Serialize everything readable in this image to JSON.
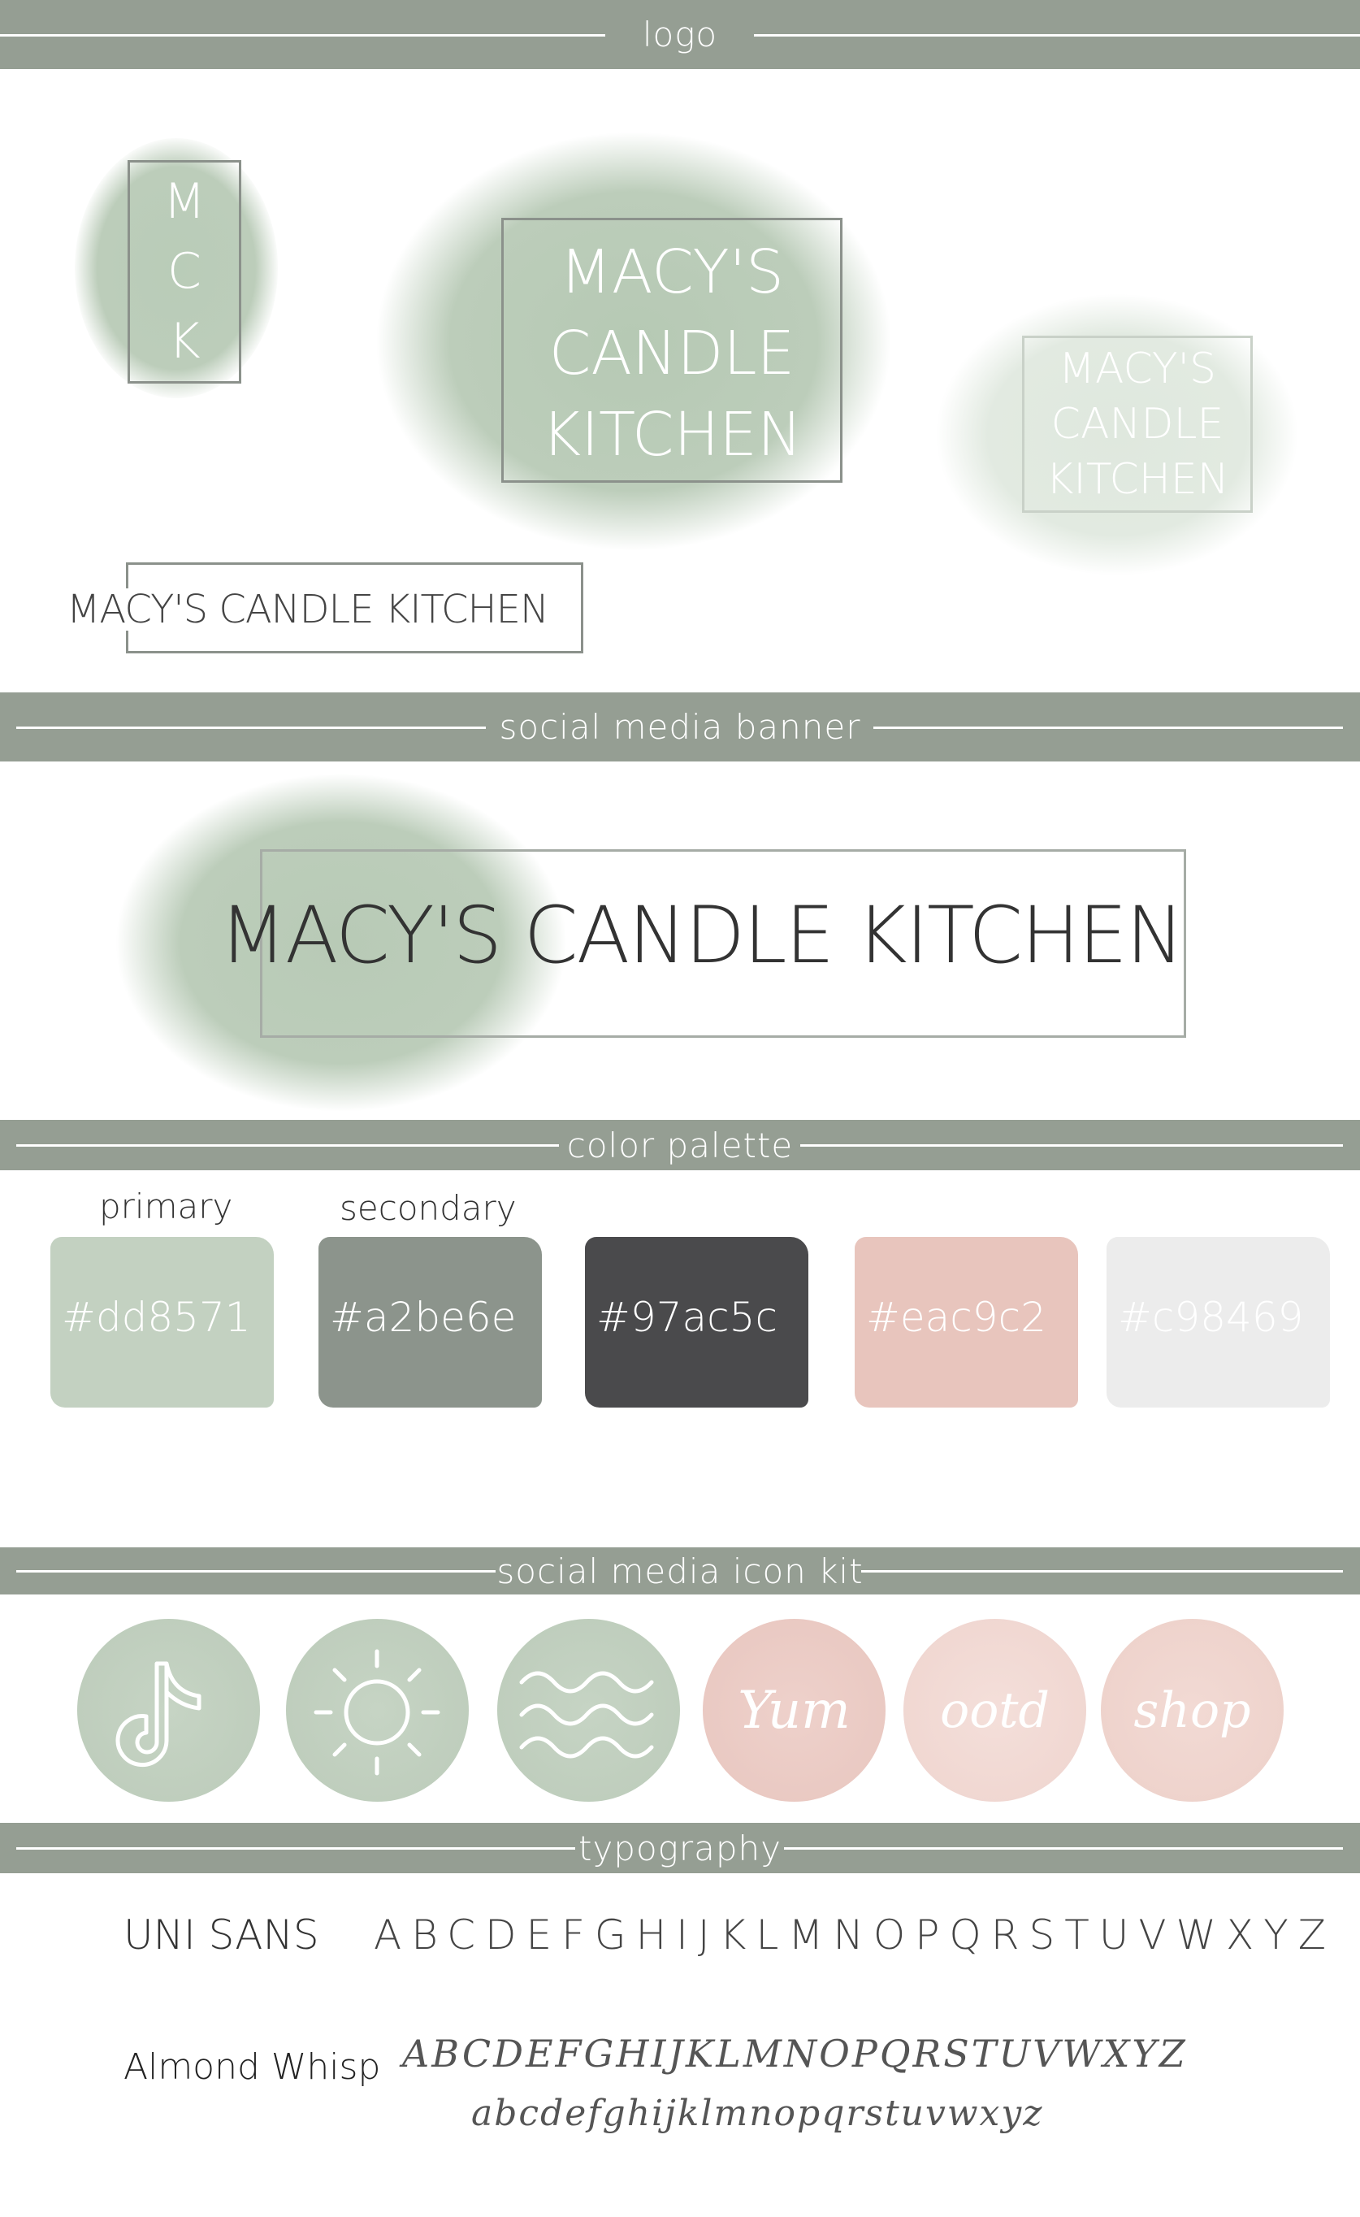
{
  "sections": {
    "logo": "logo",
    "banner": "social media banner",
    "palette": "color palette",
    "icons": "social media icon kit",
    "typography": "typography"
  },
  "logo": {
    "initials": [
      "M",
      "C",
      "K"
    ],
    "main_lines": [
      "MACY'S",
      "CANDLE",
      "KITCHEN"
    ],
    "faded_lines": [
      "MACY'S",
      "CANDLE",
      "KITCHEN"
    ],
    "wordmark": "MACY'S CANDLE KITCHEN"
  },
  "banner": {
    "wordmark": "MACY'S CANDLE KITCHEN"
  },
  "palette": {
    "primary_label": "primary",
    "secondary_label": "secondary",
    "swatches": [
      {
        "hex": "#dd8571",
        "fill": "#c3d1c1"
      },
      {
        "hex": "#a2be6e",
        "fill": "#8c948c"
      },
      {
        "hex": "#97ac5c",
        "fill": "#4a4a4c"
      },
      {
        "hex": "#eac9c2",
        "fill": "#e8c5bd"
      },
      {
        "hex": "#c98469",
        "fill": "#ececec"
      }
    ]
  },
  "icons": {
    "items": [
      {
        "name": "tiktok-icon",
        "color": "#c3d1c1",
        "text": ""
      },
      {
        "name": "sun-icon",
        "color": "#c3d1c1",
        "text": ""
      },
      {
        "name": "waves-icon",
        "color": "#c3d1c1",
        "text": ""
      },
      {
        "name": "yum-icon",
        "color": "#eccbc4",
        "text": "Yum"
      },
      {
        "name": "ootd-icon",
        "color": "#f1d8d2",
        "text": "ootd"
      },
      {
        "name": "shop-icon",
        "color": "#efd4cd",
        "text": "shop"
      }
    ]
  },
  "typography": {
    "font1_name": "UNI SANS",
    "font1_sample": "ABCDEFGHIJKLMNOPQRSTUVWXYZ",
    "font2_name": "Almond Whisp",
    "font2_upper": "ABCDEFGHIJKLMNOPQRSTUVWXYZ",
    "font2_lower": "abcdefghijklmnopqrstuvwxyz"
  }
}
